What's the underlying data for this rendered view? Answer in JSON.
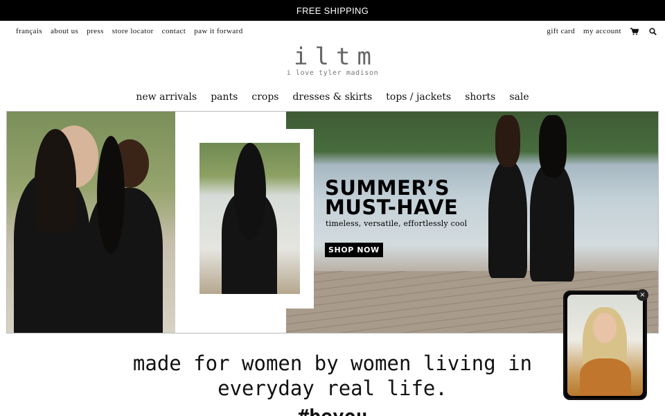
{
  "promo": {
    "text": "FREE SHIPPING"
  },
  "utility_nav": {
    "left": [
      "français",
      "about us",
      "press",
      "store locator",
      "contact",
      "paw it forward"
    ],
    "right": [
      "gift card",
      "my account"
    ],
    "icons": [
      "cart-icon",
      "search-icon"
    ]
  },
  "brand": {
    "logo": "iltm",
    "tagline": "i love tyler madison"
  },
  "main_nav": [
    "new arrivals",
    "pants",
    "crops",
    "dresses & skirts",
    "tops / jackets",
    "shorts",
    "sale"
  ],
  "hero": {
    "title_line1": "SUMMER’S",
    "title_line2": "MUST-HAVE",
    "subtitle": "timeless, versatile, effortlessly cool",
    "cta": "SHOP NOW"
  },
  "body": {
    "tagline": "made for women by women living in everyday real life.",
    "hashtag": "#beyou"
  },
  "video_widget": {
    "close_symbol": "×"
  },
  "colors": {
    "promo_bg": "#000000",
    "text": "#111111",
    "logo": "#666666"
  }
}
